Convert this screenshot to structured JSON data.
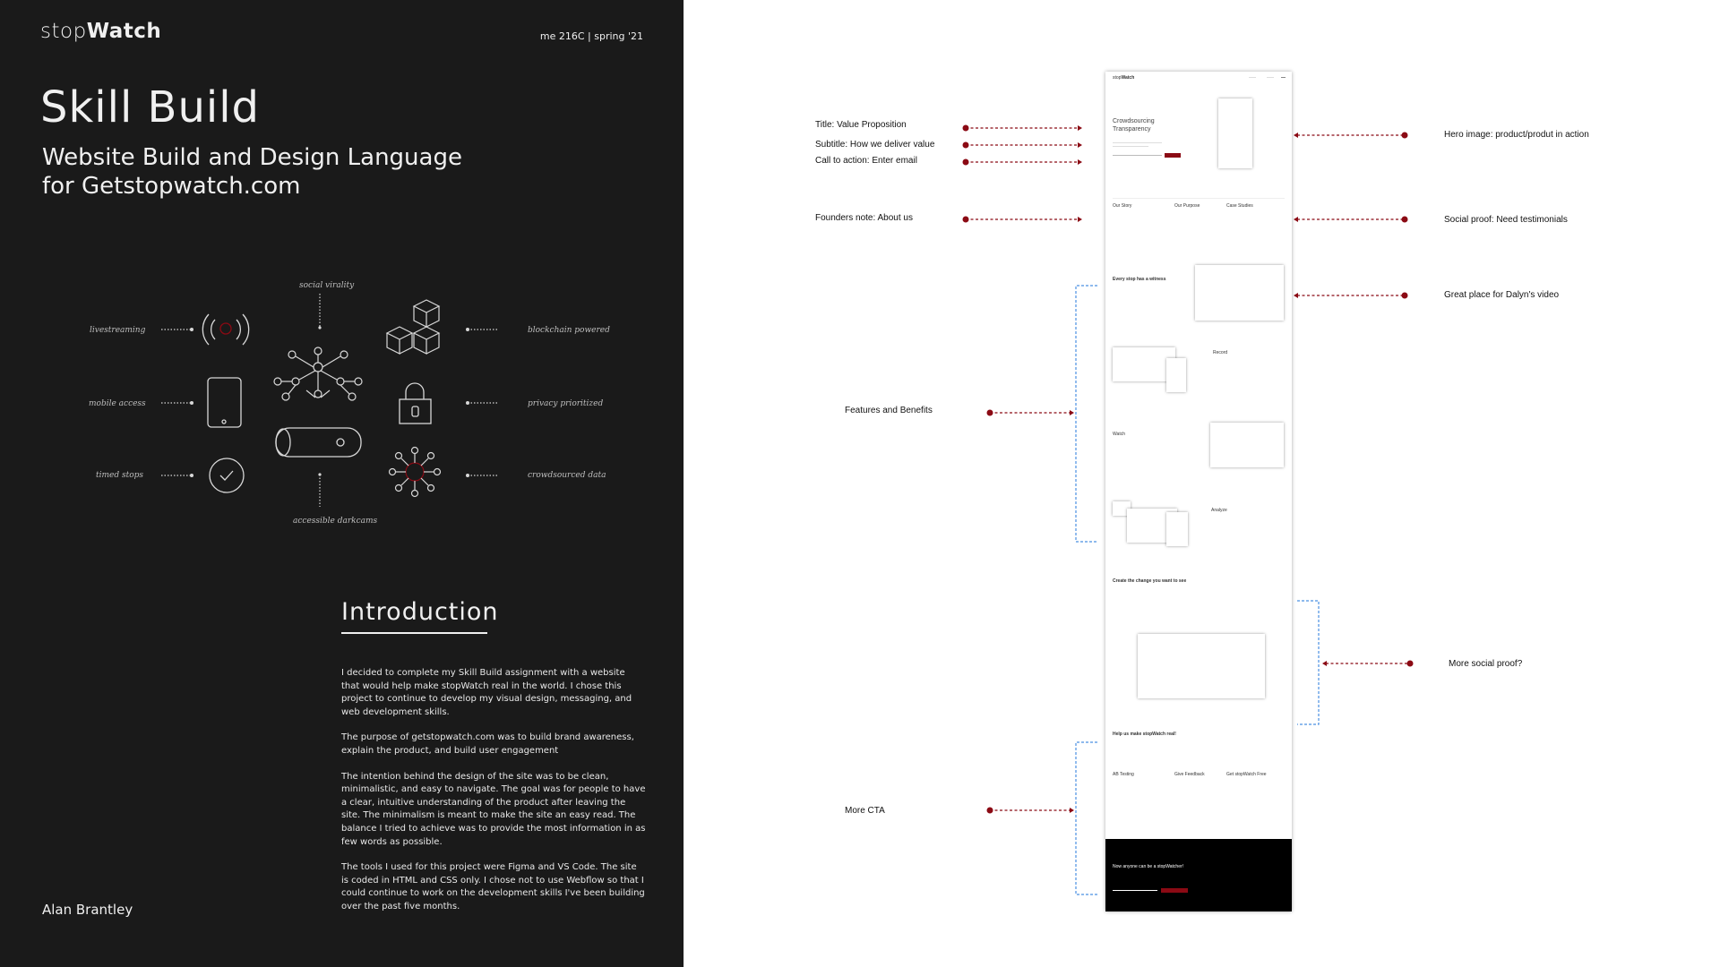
{
  "header": {
    "logo_light": "stop",
    "logo_bold": "Watch",
    "course": "me 216C | spring '21"
  },
  "hero": {
    "title": "Skill Build",
    "subtitle": "Website Build and Design Language\nfor Getstopwatch.com"
  },
  "diagram": {
    "top_label": "social virality",
    "bottom_label": "accessible darkcams",
    "left_labels": [
      "livestreaming",
      "mobile access",
      "timed stops"
    ],
    "right_labels": [
      "blockchain powered",
      "privacy prioritized",
      "crowdsourced data"
    ],
    "icons": [
      "livestream-icon",
      "mobile-icon",
      "timer-icon",
      "network-icon",
      "camera-icon",
      "blocks-icon",
      "lock-icon",
      "data-icon"
    ]
  },
  "intro": {
    "title": "Introduction",
    "paragraphs": [
      "I decided to complete my Skill Build assignment with a website that would help make stopWatch real in the world. I chose this project to continue to develop my visual design, messaging, and web development skills.",
      "The purpose of getstopwatch.com was to build brand awareness, explain the product, and build user engagement",
      "The intention behind the design of the site was to be clean, minimalistic, and easy to navigate. The goal was for people to have a clear, intuitive understanding of the product after leaving the site. The minimalism is meant to make the site an easy read. The balance I tried to achieve was to provide the most information in as few words as possible.",
      "The tools I used for this project were Figma and VS Code. The site is coded in HTML and CSS only. I chose not to use Webflow so that I could continue to work on the development skills I've been building over the past five months."
    ]
  },
  "author": "Alan Brantley",
  "annotations": {
    "left": [
      "Title: Value Proposition",
      "Subtitle: How we deliver value",
      "Call to action: Enter email",
      "Founders note: About us",
      "Features and Benefits",
      "More CTA"
    ],
    "right": [
      "Hero image: product/produt in action",
      "Social proof: Need testimonials",
      "Great place for Dalyn's video",
      "More social proof?"
    ]
  },
  "wireframe": {
    "hero_heading": "Crowdsourcing\nTransparency",
    "about_cols": [
      "Our Story",
      "Our Purpose",
      "Case Studies"
    ],
    "witness_heading": "Every stop has a witness",
    "features": [
      "Record",
      "Watch",
      "Analyze"
    ],
    "change_heading": "Create the change you want to see",
    "help_heading": "Help us make stopWatch real!",
    "cta_cols": [
      "AB Testing",
      "Give Feedback",
      "Get stopWatch Free"
    ],
    "footer_heading": "Now anyone can be a stopWatcher!"
  },
  "colors": {
    "dark_panel": "#1a1a1a",
    "accent_red": "#8b0a14",
    "bracket_blue": "#4a90e2"
  }
}
